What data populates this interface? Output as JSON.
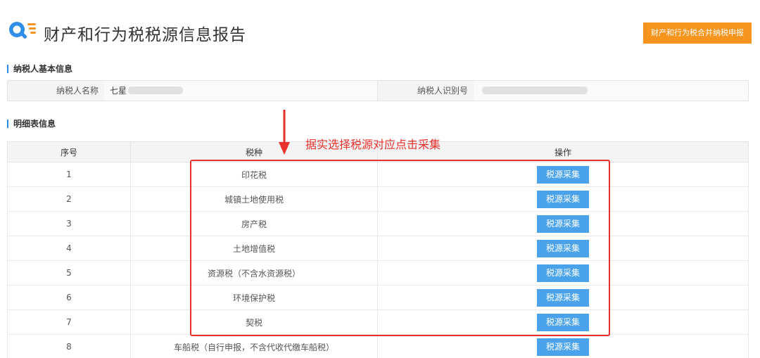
{
  "header": {
    "title": "财产和行为税税源信息报告",
    "merge_button": "财产和行为税合并纳税申报"
  },
  "taxpayer": {
    "section_title": "纳税人基本信息",
    "name_label": "纳税人名称",
    "name_value": "七星",
    "id_label": "纳税人识别号"
  },
  "detail": {
    "section_title": "明细表信息",
    "columns": [
      "序号",
      "税种",
      "操作"
    ],
    "action_label": "税源采集",
    "rows": [
      {
        "no": "1",
        "tax": "印花税"
      },
      {
        "no": "2",
        "tax": "城镇土地使用税"
      },
      {
        "no": "3",
        "tax": "房产税"
      },
      {
        "no": "4",
        "tax": "土地增值税"
      },
      {
        "no": "5",
        "tax": "资源税（不含水资源税）"
      },
      {
        "no": "6",
        "tax": "环境保护税"
      },
      {
        "no": "7",
        "tax": "契税"
      },
      {
        "no": "8",
        "tax": "车船税（自行申报，不含代收代缴车船税）"
      }
    ]
  },
  "annotation": {
    "text": "据实选择税源对应点击采集"
  },
  "colors": {
    "accent_blue": "#4aa3ea",
    "orange": "#f7941d",
    "highlight_red": "#e8302c"
  }
}
